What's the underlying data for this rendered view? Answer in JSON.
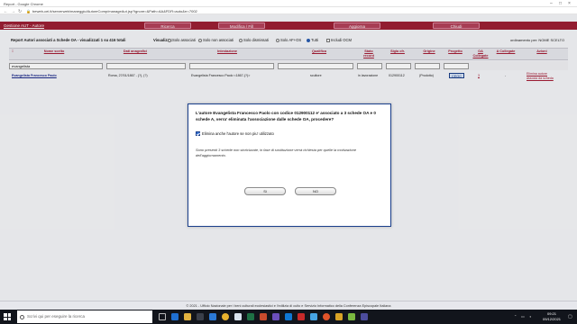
{
  "browser": {
    "tab_title": "Report - Google Chrome",
    "url": "beweb-cei.it/serverweb/maneggio/AutoreComp/manageAut.jsp?ignore=&Path=AA&FDR=auto&rr=7002"
  },
  "navbar": {
    "brand": "Gestione AUT - Autore",
    "items": [
      "Ricerca",
      "Modifica / Fill",
      "Aggiorna",
      "Chiudi"
    ]
  },
  "infobar": {
    "title": "Report Autori associati a Schede OA - visualizzati 1 su 416 totali",
    "visualizza_label": "Visualizza:",
    "radios": [
      {
        "label": "Solo associati",
        "on": false
      },
      {
        "label": "Solo non associati",
        "on": false
      },
      {
        "label": "Solo dismissati",
        "on": false
      },
      {
        "label": "Solo AF+OS",
        "on": false
      },
      {
        "label": "Tutti",
        "on": true
      }
    ],
    "checkbox_label": "Includi OCM",
    "order_label": "ordinamento per: NOME SCELTO"
  },
  "table": {
    "columns": [
      "Nome scelto",
      "Dati anagrafici",
      "Intestazione",
      "Qualifica",
      "Stato record",
      "Sigla cfr.",
      "Origine",
      "Progetto",
      "OA Collegate",
      "A Collegate",
      "Azioni"
    ],
    "filter_value": "evangelista",
    "row": {
      "name": "Evangelista Francesco Paolo",
      "dati": "Roma, 27/01/1867 - (?), (?)",
      "intestazione": "Evangelista Francesco Paolo <1867-(?)>",
      "qualifica": "scultore",
      "stato": "in lavorazione",
      "sigla": "012900112",
      "origine": "(Prodotto)",
      "progetto": "CEOC",
      "oa": "3",
      "a": "-",
      "azioni_1": "Elimina autore",
      "azioni_2": "associa da scheda"
    }
  },
  "dialog": {
    "message": "L'autore Evangelista Francesco Paolo con codice 012900112 e' associato a 3 schede OA e 0 schede A, verra' eliminata l'associazione dalle schede OA, procedere?",
    "checkbox_label": "Elimina anche l'autore se non piu' utilizzato",
    "info": "Sono presenti 3 schede non storicizzate, in fase di sostituzione verrà richiesta per quelle la motivazione dell'aggiornamento.",
    "ok_label": "Si",
    "cancel_label": "NO"
  },
  "footer": {
    "text": "© 2021 - Ufficio Nazionale per i beni culturali ecclesiastici e l'edilizia di culto e Servizio Informatico della Conferenza Episcopale Italiana"
  },
  "taskbar": {
    "search_placeholder": "Scrivi qui per eseguire la ricerca",
    "time": "09:21",
    "date": "09/12/2021"
  }
}
